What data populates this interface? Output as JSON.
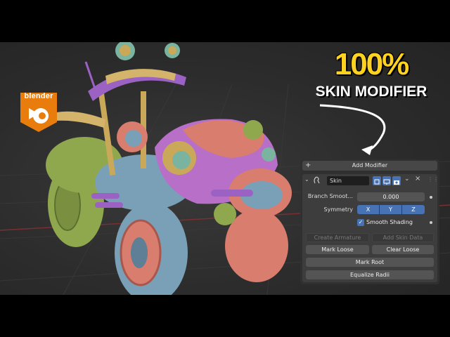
{
  "thumbnail": {
    "headline": "100%",
    "subheadline": "SKIN MODIFIER",
    "logo_text": "blender",
    "colors": {
      "headline": "#ffd21f",
      "logo_bg": "#e87d0d",
      "accent": "#4772b3"
    }
  },
  "panel": {
    "add_modifier_label": "Add Modifier",
    "add_icon": "plus-icon",
    "modifier": {
      "name": "Skin",
      "icon": "skin-modifier-icon",
      "branch_smoothing_label": "Branch Smoot...",
      "branch_smoothing_value": "0.000",
      "symmetry_label": "Symmetry",
      "axes": [
        "X",
        "Y",
        "Z"
      ],
      "smooth_shading_label": "Smooth Shading",
      "smooth_shading_checked": true,
      "buttons": {
        "create_armature": "Create Armature",
        "add_skin_data": "Add Skin Data",
        "mark_loose": "Mark Loose",
        "clear_loose": "Clear Loose",
        "mark_root": "Mark Root",
        "equalize_radii": "Equalize Radii"
      }
    }
  }
}
